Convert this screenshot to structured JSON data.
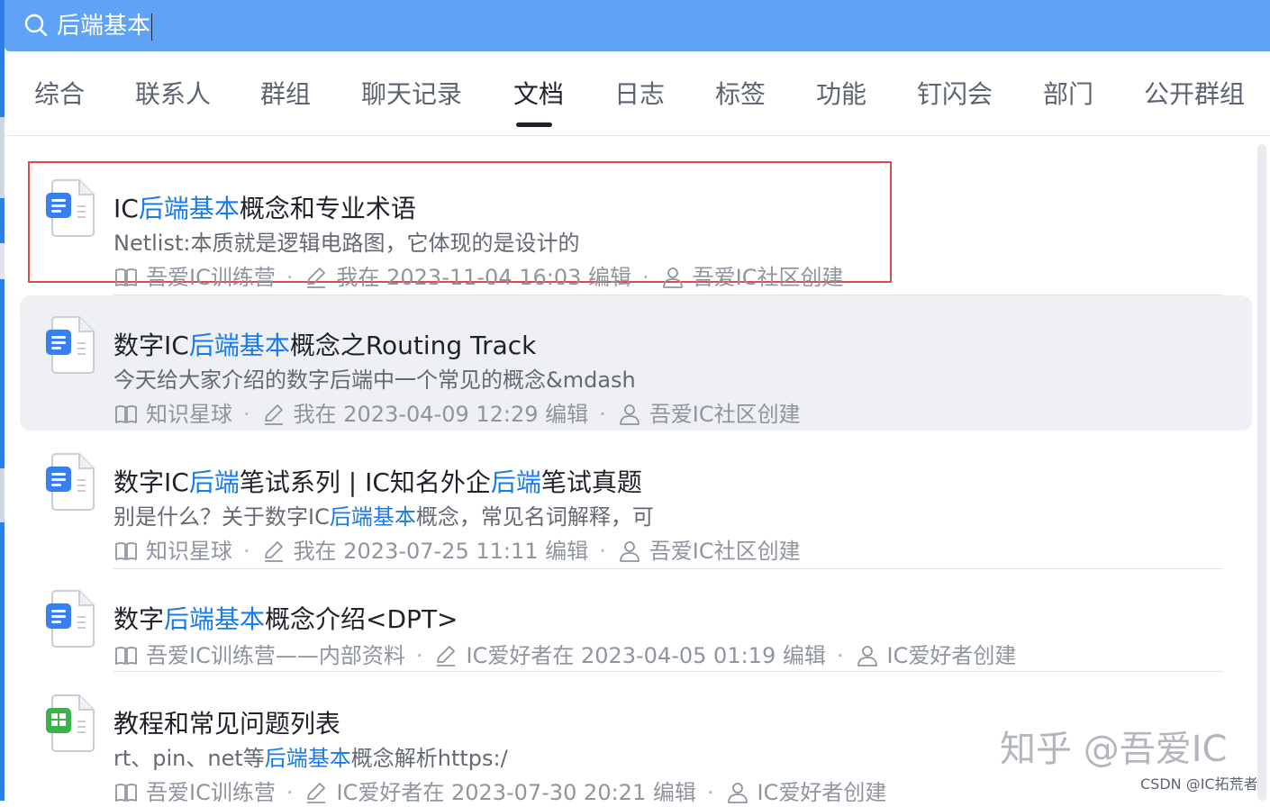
{
  "search": {
    "query": "后端基本"
  },
  "tabs": [
    {
      "label": "综合"
    },
    {
      "label": "联系人"
    },
    {
      "label": "群组"
    },
    {
      "label": "聊天记录"
    },
    {
      "label": "文档"
    },
    {
      "label": "日志"
    },
    {
      "label": "标签"
    },
    {
      "label": "功能"
    },
    {
      "label": "钉闪会"
    },
    {
      "label": "部门"
    },
    {
      "label": "公开群组"
    }
  ],
  "active_tab": "文档",
  "results": [
    {
      "icon": "doc-icon",
      "title_parts": [
        "IC",
        "后端基本",
        "概念和专业术语"
      ],
      "snippet_parts": [
        "Netlist:本质就是逻辑电路图，它体现的是设计的"
      ],
      "space": "吾爱IC训练营",
      "edited": "我在 2023-11-04 16:03 编辑",
      "creator": "吾爱IC社区创建"
    },
    {
      "icon": "doc-icon",
      "title_parts": [
        "数字IC",
        "后端基本",
        "概念之Routing Track"
      ],
      "snippet_parts": [
        "今天给大家介绍的数字后端中一个常见的概念&mdash"
      ],
      "space": "知识星球",
      "edited": "我在 2023-04-09 12:29 编辑",
      "creator": "吾爱IC社区创建"
    },
    {
      "icon": "doc-icon",
      "title_parts": [
        "数字IC",
        "后端",
        "笔试系列 | IC知名外企",
        "后端",
        "笔试真题"
      ],
      "snippet_parts": [
        "别是什么？关于数字IC",
        "后端基本",
        "概念，常见名词解释，可"
      ],
      "space": "知识星球",
      "edited": "我在 2023-07-25 11:11 编辑",
      "creator": "吾爱IC社区创建"
    },
    {
      "icon": "doc-icon",
      "title_parts": [
        "数字",
        "后端基本",
        "概念介绍<DPT>"
      ],
      "snippet_parts": [],
      "space": "吾爱IC训练营——内部资料",
      "edited": "IC爱好者在 2023-04-05 01:19 编辑",
      "creator": "IC爱好者创建"
    },
    {
      "icon": "sheet-icon",
      "title_parts": [
        "教程和常见问题列表"
      ],
      "snippet_parts": [
        "rt、pin、net等",
        "后端基本",
        "概念解析https:/"
      ],
      "space": "吾爱IC训练营",
      "edited": "IC爱好者在 2023-07-30 20:21 编辑",
      "creator": "IC爱好者创建"
    }
  ],
  "watermark": "知乎 @吾爱IC",
  "credit": "CSDN @IC拓荒者",
  "colors": {
    "accent": "#1a7ae6",
    "search_bar": "#5ea3f6",
    "highlight_box": "#d94c4c"
  }
}
